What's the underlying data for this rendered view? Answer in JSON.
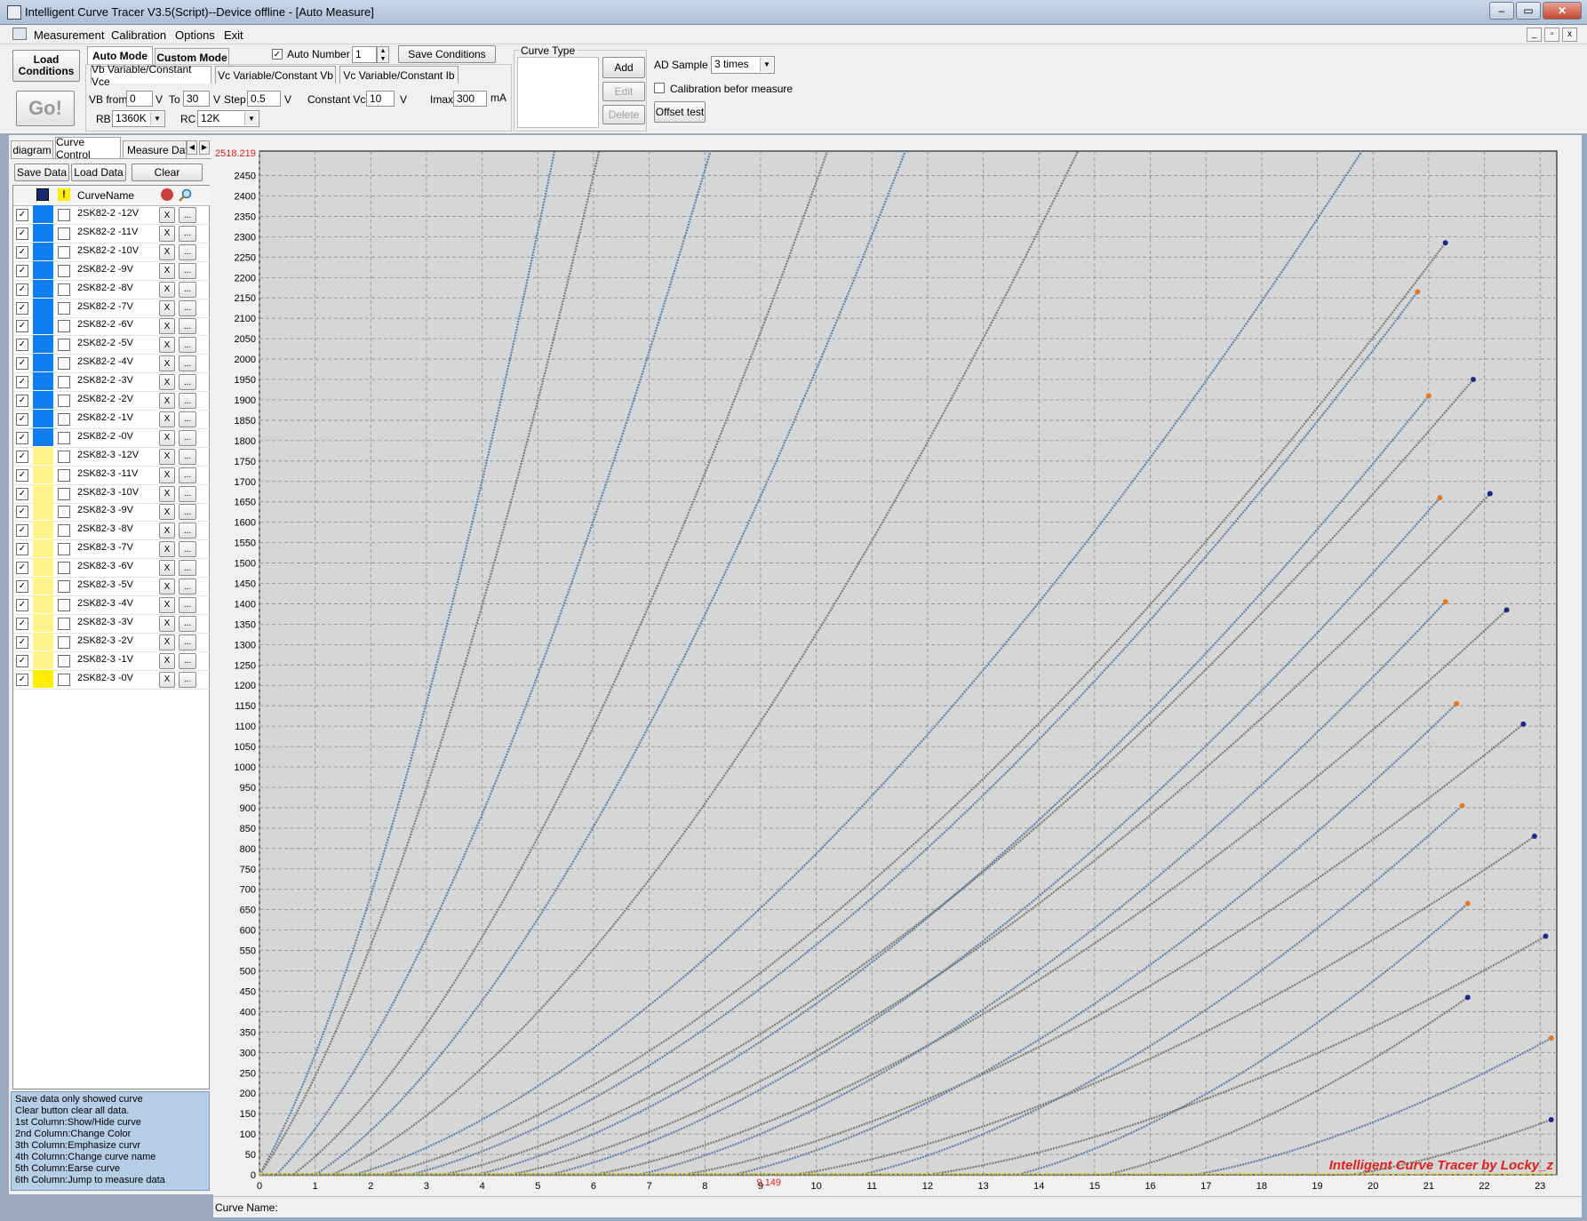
{
  "window": {
    "title": "Intelligent Curve Tracer V3.5(Script)--Device offline - [Auto Measure]",
    "min_label": "–",
    "max_label": "▭",
    "close_label": "✕"
  },
  "menu": [
    "Measurement",
    "Calibration",
    "Options",
    "Exit"
  ],
  "mdi_buttons": [
    "_",
    "▫",
    "x"
  ],
  "toolbar": {
    "load_conditions": "Load Conditions",
    "go": "Go!",
    "mode_tabs": [
      "Auto Mode",
      "Custom Mode"
    ],
    "auto_number_label": "Auto Number",
    "auto_number_value": "1",
    "save_conditions": "Save Conditions",
    "sub_tabs": [
      "Vb Variable/Constant Vce",
      "Vc Variable/Constant Vb",
      "Vc Variable/Constant Ib"
    ],
    "vb_from_label": "VB from",
    "vb_from_value": "0",
    "v_unit": "V",
    "to_label": "To",
    "to_value": "30",
    "step_label": "Step",
    "step_value": "0.5",
    "constant_vce_label": "Constant Vce",
    "constant_vce_value": "10",
    "imax_label": "Imax",
    "imax_value": "300",
    "ma_unit": "mA",
    "rb_label": "RB",
    "rb_value": "1360K",
    "rc_label": "RC",
    "rc_value": "12K",
    "curve_type_label": "Curve Type",
    "add": "Add",
    "edit": "Edit",
    "delete": "Delete",
    "ad_sample_label": "AD Sample",
    "ad_sample_value": "3 times",
    "calibration_label": "Calibration befor measure",
    "offset_test": "Offset test"
  },
  "left_tabs": [
    "diagram",
    "Curve Control",
    "Measure Data"
  ],
  "left_buttons": {
    "save": "Save Data",
    "load": "Load Data",
    "clear": "Clear"
  },
  "grid": {
    "header_name": "CurveName",
    "x_label": "X",
    "dots_label": "...",
    "check_mark": "✓",
    "rows": [
      {
        "name": "2SK82-2 -12V",
        "color": "#0f7ef0",
        "emph": false
      },
      {
        "name": "2SK82-2 -11V",
        "color": "#0f7ef0",
        "emph": false
      },
      {
        "name": "2SK82-2 -10V",
        "color": "#0f7ef0",
        "emph": false
      },
      {
        "name": "2SK82-2 -9V",
        "color": "#0f7ef0",
        "emph": false
      },
      {
        "name": "2SK82-2 -8V",
        "color": "#0f7ef0",
        "emph": false
      },
      {
        "name": "2SK82-2 -7V",
        "color": "#0f7ef0",
        "emph": false
      },
      {
        "name": "2SK82-2 -6V",
        "color": "#0f7ef0",
        "emph": false
      },
      {
        "name": "2SK82-2 -5V",
        "color": "#0f7ef0",
        "emph": false
      },
      {
        "name": "2SK82-2 -4V",
        "color": "#0f7ef0",
        "emph": false
      },
      {
        "name": "2SK82-2 -3V",
        "color": "#0f7ef0",
        "emph": false
      },
      {
        "name": "2SK82-2 -2V",
        "color": "#0f7ef0",
        "emph": false
      },
      {
        "name": "2SK82-2 -1V",
        "color": "#0f7ef0",
        "emph": false
      },
      {
        "name": "2SK82-2 -0V",
        "color": "#0f7ef0",
        "emph": false
      },
      {
        "name": "2SK82-3 -12V",
        "color": "#fff48a",
        "emph": false
      },
      {
        "name": "2SK82-3 -11V",
        "color": "#fff48a",
        "emph": false
      },
      {
        "name": "2SK82-3 -10V",
        "color": "#fff48a",
        "emph": false
      },
      {
        "name": "2SK82-3 -9V",
        "color": "#fff48a",
        "emph": false
      },
      {
        "name": "2SK82-3 -8V",
        "color": "#fff48a",
        "emph": false
      },
      {
        "name": "2SK82-3 -7V",
        "color": "#fff48a",
        "emph": false
      },
      {
        "name": "2SK82-3 -6V",
        "color": "#fff48a",
        "emph": false
      },
      {
        "name": "2SK82-3 -5V",
        "color": "#fff48a",
        "emph": false
      },
      {
        "name": "2SK82-3 -4V",
        "color": "#fff48a",
        "emph": false
      },
      {
        "name": "2SK82-3 -3V",
        "color": "#fff48a",
        "emph": false
      },
      {
        "name": "2SK82-3 -2V",
        "color": "#fff48a",
        "emph": false
      },
      {
        "name": "2SK82-3 -1V",
        "color": "#fff48a",
        "emph": false
      },
      {
        "name": "2SK82-3 -0V",
        "color": "#ffee00",
        "emph": false
      }
    ]
  },
  "help_text": [
    "  Save data only showed curve",
    "  Clear button clear all data.",
    "1st Column:Show/Hide curve",
    "2nd Column:Change Color",
    "3th Column:Emphasize curvr",
    "4th Column:Change curve name",
    "5th Column:Earse curve",
    "6th Column:Jump to measure data"
  ],
  "chart": {
    "cursor_y_label": "2518.219",
    "cursor_x_label": "9.149",
    "watermark": "Intelligent Curve Tracer by Locky_z",
    "curve_name_label": "Curve Name:"
  },
  "chart_data": {
    "type": "scatter",
    "x_ticks": [
      "0",
      "1",
      "2",
      "3",
      "4",
      "5",
      "6",
      "7",
      "8",
      "9",
      "10",
      "11",
      "12",
      "13",
      "14",
      "15",
      "16",
      "17",
      "18",
      "19",
      "20",
      "21",
      "22",
      "23"
    ],
    "y_ticks": [
      "0",
      "50",
      "100",
      "150",
      "200",
      "250",
      "300",
      "350",
      "400",
      "450",
      "500",
      "550",
      "600",
      "650",
      "700",
      "750",
      "800",
      "850",
      "900",
      "950",
      "1000",
      "1050",
      "1100",
      "1150",
      "1200",
      "1250",
      "1300",
      "1350",
      "1400",
      "1450",
      "1500",
      "1550",
      "1600",
      "1650",
      "1700",
      "1750",
      "1800",
      "1850",
      "1900",
      "1950",
      "2000",
      "2050",
      "2100",
      "2150",
      "2200",
      "2250",
      "2300",
      "2350",
      "2400",
      "2450"
    ],
    "xlim": [
      0,
      23.3
    ],
    "ylim": [
      0,
      2510
    ],
    "grid": true,
    "colors": {
      "series_a": "#5f7fa5",
      "series_b": "#7a7a6e",
      "endpoint_a": "#e07a20",
      "endpoint_b": "#1a2a8a",
      "cursor": "#e02020"
    },
    "series": [
      {
        "vg": 0,
        "vt": 0,
        "k": 0,
        "x_end": 5.3,
        "y_end": 2510
      },
      {
        "vg": 0,
        "vt": 0,
        "k": 0,
        "x_end": 6.1,
        "y_end": 2510
      },
      {
        "vg": 1,
        "vt": 0.3,
        "k": 0,
        "x_end": 8.1,
        "y_end": 2510
      },
      {
        "vg": 2,
        "vt": 0.6,
        "k": 0,
        "x_end": 10.2,
        "y_end": 2510
      },
      {
        "vg": 3,
        "vt": 1.0,
        "k": 0,
        "x_end": 11.6,
        "y_end": 2510
      },
      {
        "vg": 4,
        "vt": 1.3,
        "k": 0,
        "x_end": 14.7,
        "y_end": 2510
      },
      {
        "vg": 5,
        "vt": 1.7,
        "k": 0,
        "x_end": 19.8,
        "y_end": 2510
      },
      {
        "vg": 6,
        "vt": 2.2,
        "k": 0,
        "x_end": 21.3,
        "y_end": 2285
      },
      {
        "vg": 7,
        "vt": 2.7,
        "k": 0,
        "x_end": 20.8,
        "y_end": 2165
      },
      {
        "vg": 8,
        "vt": 3.3,
        "k": 0,
        "x_end": 21.8,
        "y_end": 1950
      },
      {
        "vg": 9,
        "vt": 3.9,
        "k": 0,
        "x_end": 21.0,
        "y_end": 1910
      },
      {
        "vg": 10,
        "vt": 4.5,
        "k": 0,
        "x_end": 22.1,
        "y_end": 1670
      },
      {
        "vg": 11,
        "vt": 5.2,
        "k": 0,
        "x_end": 21.2,
        "y_end": 1660
      },
      {
        "vg": 12,
        "vt": 6.0,
        "k": 0,
        "x_end": 22.4,
        "y_end": 1385
      },
      {
        "vg": 13,
        "vt": 6.8,
        "k": 0,
        "x_end": 21.3,
        "y_end": 1405
      },
      {
        "vg": 14,
        "vt": 7.6,
        "k": 0,
        "x_end": 22.7,
        "y_end": 1105
      },
      {
        "vg": 15,
        "vt": 8.5,
        "k": 0,
        "x_end": 21.5,
        "y_end": 1155
      },
      {
        "vg": 16,
        "vt": 9.6,
        "k": 0,
        "x_end": 22.9,
        "y_end": 830
      },
      {
        "vg": 17,
        "vt": 10.8,
        "k": 0,
        "x_end": 21.6,
        "y_end": 905
      },
      {
        "vg": 18,
        "vt": 12.0,
        "k": 0,
        "x_end": 23.1,
        "y_end": 585
      },
      {
        "vg": 19,
        "vt": 13.6,
        "k": 0,
        "x_end": 21.7,
        "y_end": 665
      },
      {
        "vg": 20,
        "vt": 15.2,
        "k": 0,
        "x_end": 21.7,
        "y_end": 435
      },
      {
        "vg": 21,
        "vt": 16.8,
        "k": 0,
        "x_end": 23.2,
        "y_end": 335
      },
      {
        "vg": 22,
        "vt": 19.6,
        "k": 0,
        "x_end": 23.2,
        "y_end": 135
      }
    ]
  }
}
